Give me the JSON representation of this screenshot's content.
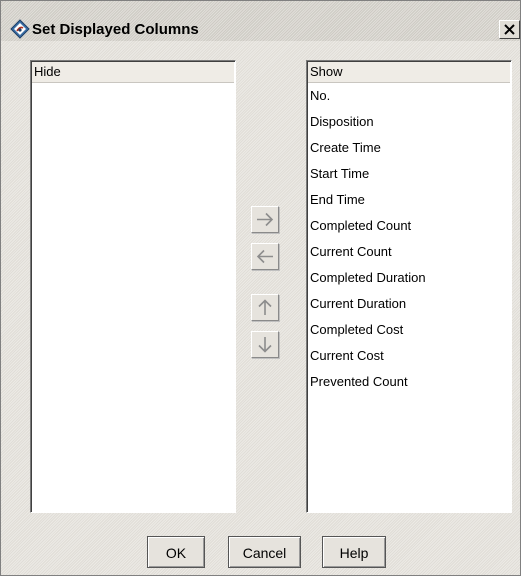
{
  "window": {
    "title": "Set Displayed Columns"
  },
  "title_icon": "java-cup-icon",
  "close_icon": "close-x-icon",
  "hide_list": {
    "header": "Hide",
    "items": []
  },
  "show_list": {
    "header": "Show",
    "items": [
      "No.",
      "Disposition",
      "Create Time",
      "Start Time",
      "End Time",
      "Completed Count",
      "Current Count",
      "Completed Duration",
      "Current Duration",
      "Completed Cost",
      "Current Cost",
      "Prevented Count"
    ]
  },
  "move_buttons": {
    "right_icon": "arrow-right-icon",
    "left_icon": "arrow-left-icon",
    "up_icon": "arrow-up-icon",
    "down_icon": "arrow-down-icon"
  },
  "buttons": {
    "ok": "OK",
    "cancel": "Cancel",
    "help": "Help"
  },
  "colors": {
    "window_bg": "#e7e4de",
    "list_bg": "#ffffff",
    "arrow_disabled": "#8d8d8d"
  }
}
